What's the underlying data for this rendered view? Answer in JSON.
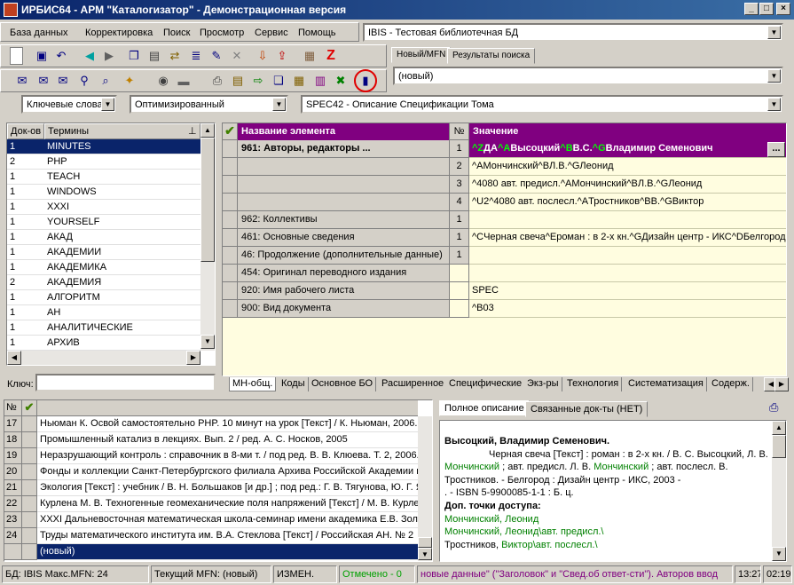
{
  "window": {
    "title": "ИРБИС64 - АРМ \"Каталогизатор\" - Демонстрационная версия",
    "min": "_",
    "max": "□",
    "close": "×"
  },
  "menu": [
    "База данных",
    "Корректировка",
    "Поиск",
    "Просмотр",
    "Сервис",
    "Помощь"
  ],
  "database_combo": "IBIS - Тестовая библиотечная БД",
  "right_tabs": [
    "Новый/MFN",
    "Результаты поиска"
  ],
  "new_combo": "(новый)",
  "search_bar": {
    "mode": "Ключевые слова",
    "optimization": "Оптимизированный",
    "worksheet": "SPEC42 - Описание Спецификации Тома"
  },
  "terms": {
    "col_count": "Док-ов",
    "col_term": "Термины",
    "pin": "⊥",
    "rows": [
      {
        "count": "1",
        "term": "MINUTES"
      },
      {
        "count": "2",
        "term": "PHP"
      },
      {
        "count": "1",
        "term": "TEACH"
      },
      {
        "count": "1",
        "term": "WINDOWS"
      },
      {
        "count": "1",
        "term": "XXXI"
      },
      {
        "count": "1",
        "term": "YOURSELF"
      },
      {
        "count": "1",
        "term": "АКАД"
      },
      {
        "count": "1",
        "term": "АКАДЕМИИ"
      },
      {
        "count": "1",
        "term": "АКАДЕМИКА"
      },
      {
        "count": "2",
        "term": "АКАДЕМИЯ"
      },
      {
        "count": "1",
        "term": "АЛГОРИТМ"
      },
      {
        "count": "1",
        "term": "АН"
      },
      {
        "count": "1",
        "term": "АНАЛИТИЧЕСКИЕ"
      },
      {
        "count": "1",
        "term": "АРХИВ"
      }
    ],
    "key_label": "Ключ:",
    "key_value": ""
  },
  "fields": {
    "col_name": "Название элемента",
    "col_num": "№",
    "col_value": "Значение",
    "rows": [
      {
        "name": "961: Авторы, редакторы ...",
        "num": "1",
        "value_parts": [
          "^Z",
          "ДА",
          "^A",
          "Высоцкий",
          "^B",
          "В.С.",
          "^G",
          "Владимир Семенович"
        ],
        "selected": true
      },
      {
        "name": "",
        "num": "2",
        "value": "^AМончинский^BЛ.В.^GЛеонид"
      },
      {
        "name": "",
        "num": "3",
        "value": "^4080 авт. предисл.^AМончинский^BЛ.В.^GЛеонид"
      },
      {
        "name": "",
        "num": "4",
        "value": "^U2^4080 авт. послесл.^AТростников^BВ.^GВиктор"
      },
      {
        "name": "962: Коллективы",
        "num": "1",
        "value": ""
      },
      {
        "name": "461: Основные сведения",
        "num": "1",
        "value": "^CЧерная свеча^Eроман : в 2-х кн.^GДизайн центр - ИКС^DБелгород-"
      },
      {
        "name": "46: Продолжение (дополнительные данные)",
        "num": "1",
        "value": ""
      },
      {
        "name": "454: Оригинал переводного издания",
        "num": "",
        "value": ""
      },
      {
        "name": "920: Имя рабочего листа",
        "num": "",
        "value": "SPEC"
      },
      {
        "name": "900: Вид документа",
        "num": "",
        "value": "^B03"
      }
    ],
    "ellipsis": "..."
  },
  "bottom_tabs": [
    "МН-общ.",
    "Коды",
    "Основное БО",
    "Расширенное",
    "Специфические",
    "Экз-ры",
    "Технология",
    "Систематизация",
    "Содерж."
  ],
  "docs": {
    "col_num": "№",
    "rows": [
      {
        "n": "17",
        "text": "Ньюман К. Освой самостоятельно PHP. 10 минут на урок [Текст] / К. Ньюман, 2006."
      },
      {
        "n": "18",
        "text": "Промышленный катализ в лекциях. Вып. 2 / ред. А. С. Носков, 2005"
      },
      {
        "n": "19",
        "text": "Неразрушающий контроль : справочник в 8-ми т. / под ред. В. В. Клюева. Т. 2, 2006."
      },
      {
        "n": "20",
        "text": "Фонды и коллекции Санкт-Петербургского филиала Архива Российской Академии н"
      },
      {
        "n": "21",
        "text": "Экология [Текст] : учебник / В. Н. Большаков [и др.] ; под ред.: Г. В. Тягунова, Ю. Г. Я"
      },
      {
        "n": "22",
        "text": "Курлена М. В. Техногенные геомеханические поля напряжений [Текст] / М. В. Курлен"
      },
      {
        "n": "23",
        "text": "XXXI Дальневосточная математическая школа-семинар имени академика Е.В. Золо"
      },
      {
        "n": "24",
        "text": "Труды математического института им. В.А. Стеклова [Текст] / Российская АН. № 2"
      },
      {
        "n": "",
        "text": "(новый)",
        "selected": true
      }
    ]
  },
  "desc_tabs": [
    "Полное описание",
    "Связанные док-ты (НЕТ)"
  ],
  "description": {
    "author": "Высоцкий, Владимир Семенович.",
    "line1": "Черная свеча [Текст] : роман : в 2-х кн. / В. С. Высоцкий, Л. В.",
    "line2a": "Мончинский",
    "line2b": "; авт. предисл. Л. В.",
    "line2c": "Мончинский",
    "line2d": "; авт. послесл. В.",
    "line3": "Тростников. - Белгород : Дизайн центр - ИКС, 2003 -",
    "line4": ". - ISBN 5-9900085-1-1 : Б. ц.",
    "access_title": "Доп. точки доступа:",
    "a1": "Мончинский, Леонид",
    "a2": "Мончинский, Леонид\\авт. предисл.\\",
    "a3a": "Тростников,",
    "a3b": "Виктор\\авт. послесл.\\"
  },
  "status": {
    "db": "БД: IBIS Макс.MFN: 24",
    "mfn": "Текущий MFN: (новый)",
    "changed": "ИЗМЕН.",
    "marked": "Отмечено - 0",
    "hint": "новые данные\" (\"Заголовок\" и \"Свед.об ответ-сти\"). Авторов ввод",
    "time1": "13:27",
    "time2": "02:19"
  }
}
